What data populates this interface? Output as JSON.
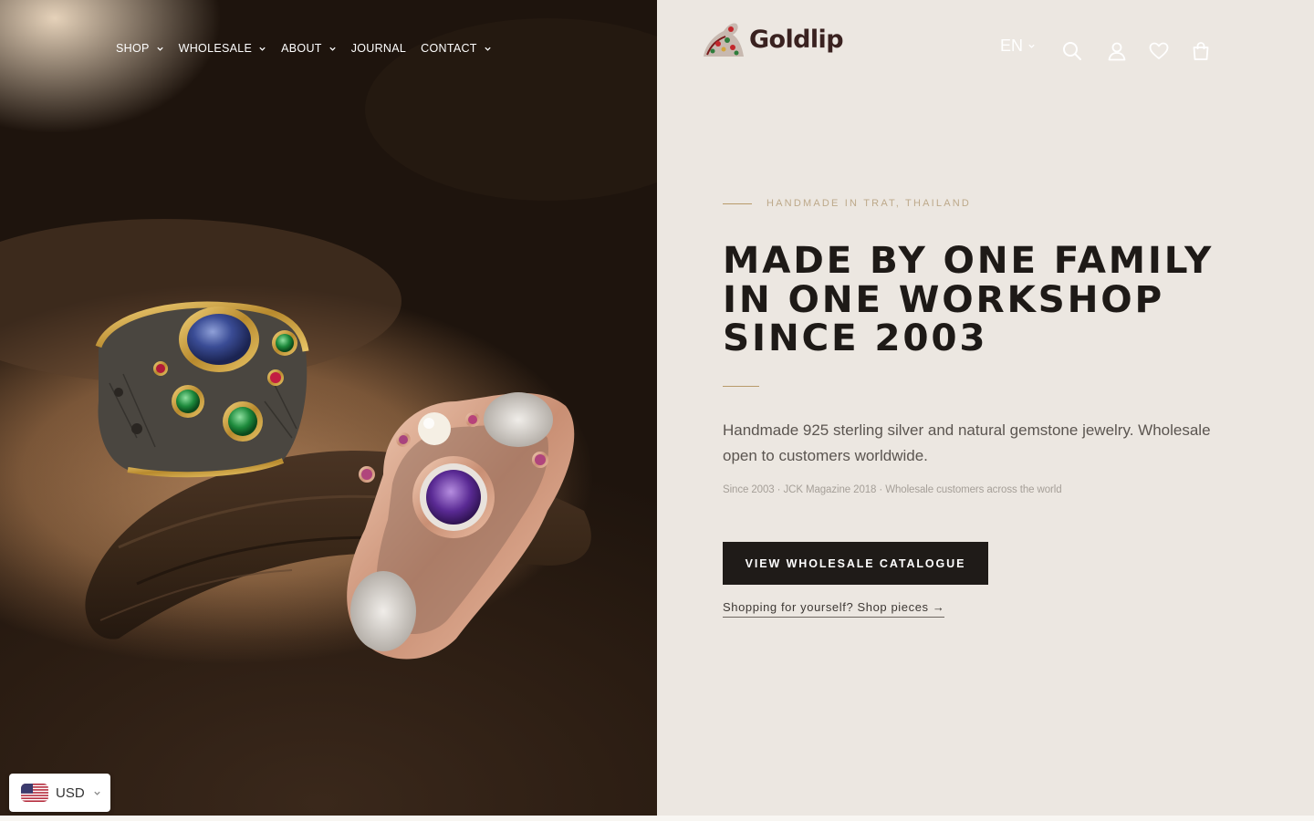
{
  "nav": {
    "items": [
      {
        "label": "SHOP",
        "has_dropdown": true
      },
      {
        "label": "WHOLESALE",
        "has_dropdown": true
      },
      {
        "label": "ABOUT",
        "has_dropdown": true
      },
      {
        "label": "JOURNAL",
        "has_dropdown": false
      },
      {
        "label": "CONTACT",
        "has_dropdown": true
      }
    ]
  },
  "header": {
    "logo_text": "Goldlip",
    "language": "EN",
    "icons": [
      "search-icon",
      "account-icon",
      "wishlist-icon",
      "cart-icon"
    ]
  },
  "hero": {
    "eyebrow": "HANDMADE IN TRAT, THAILAND",
    "headline": "MADE BY ONE FAMILY IN ONE WORKSHOP SINCE 2003",
    "lead": "Handmade 925 sterling silver and natural gemstone jewelry. Wholesale open to customers worldwide.",
    "meta": "Since 2003 · JCK Magazine 2018 · Wholesale customers across the world",
    "cta_label": "VIEW WHOLESALE CATALOGUE",
    "secondary_link": "Shopping for yourself? Shop pieces →"
  },
  "currency": {
    "code": "USD",
    "flag": "us-flag-icon"
  },
  "colors": {
    "panel_bg": "#ece7e1",
    "accent_gold": "#b89a6a",
    "cta_bg": "#1f1b18",
    "text_dark": "#1e1a17"
  }
}
